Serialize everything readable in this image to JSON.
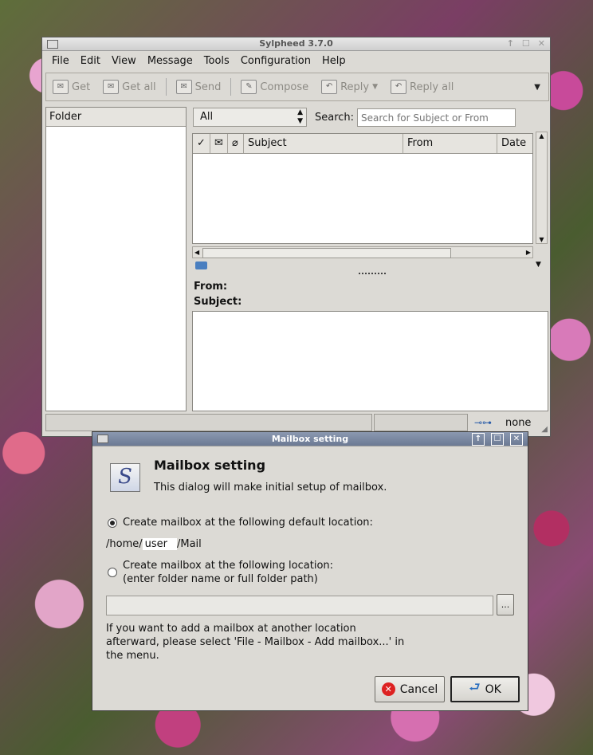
{
  "main_window": {
    "title": "Sylpheed 3.7.0",
    "menu": [
      "File",
      "Edit",
      "View",
      "Message",
      "Tools",
      "Configuration",
      "Help"
    ],
    "toolbar": {
      "get": "Get",
      "get_all": "Get all",
      "send": "Send",
      "compose": "Compose",
      "reply": "Reply",
      "reply_all": "Reply all"
    },
    "folder_header": "Folder",
    "filter_value": "All",
    "search_label": "Search:",
    "search_placeholder": "Search for Subject or From",
    "columns": {
      "subject": "Subject",
      "from": "From",
      "date": "Date"
    },
    "from_label": "From:",
    "subject_label": "Subject:",
    "status_right": "none"
  },
  "dialog": {
    "title": "Mailbox setting",
    "heading": "Mailbox setting",
    "description": "This dialog will make initial setup of mailbox.",
    "option_default": "Create mailbox at the following default location:",
    "path_prefix": "/home/",
    "path_user": "user",
    "path_suffix": "/Mail",
    "option_custom_line1": "Create mailbox at the following location:",
    "option_custom_line2": "(enter folder name or full folder path)",
    "browse_label": "...",
    "info_line1": "If you want to add a mailbox at another location",
    "info_line2": "afterward, please select 'File - Mailbox - Add mailbox...' in",
    "info_line3": "the menu.",
    "cancel_label": "Cancel",
    "ok_label": "OK"
  }
}
